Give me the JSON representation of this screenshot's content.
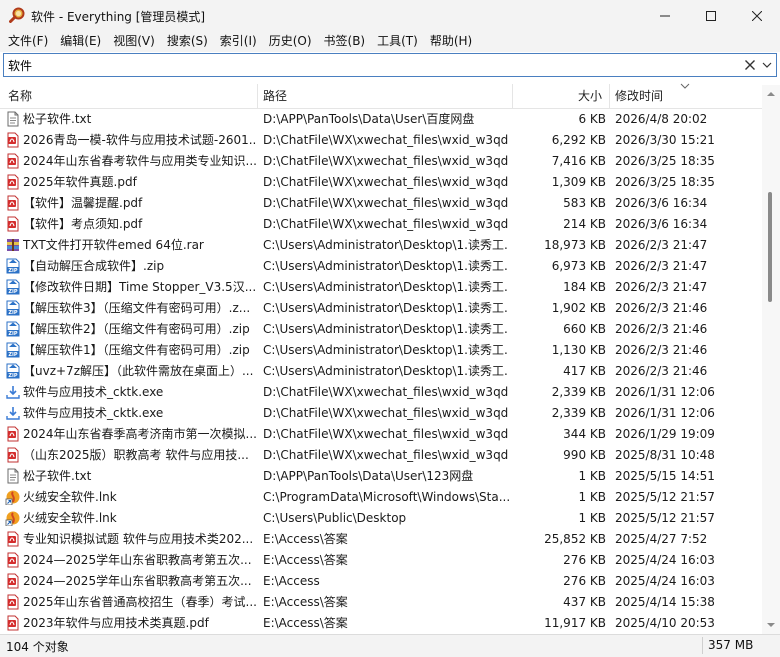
{
  "window": {
    "title": "软件 - Everything [管理员模式]",
    "icon": "magnifier-app-icon",
    "minimize_icon": "minimize-icon",
    "maximize_icon": "maximize-icon",
    "close_icon": "close-icon"
  },
  "menu": [
    "文件(F)",
    "编辑(E)",
    "视图(V)",
    "搜索(S)",
    "索引(I)",
    "历史(O)",
    "书签(B)",
    "工具(T)",
    "帮助(H)"
  ],
  "search": {
    "value": "软件",
    "clear_icon": "close-icon",
    "dropdown_icon": "chevron-down-icon"
  },
  "columns": {
    "name": "名称",
    "path": "路径",
    "size": "大小",
    "modified": "修改时间"
  },
  "colors": {
    "accent": "#4a7fc0",
    "pdf": "#d42d2d",
    "zip": "#2c72c7",
    "exe": "#3a7bd5"
  },
  "files": [
    {
      "name": "松子软件.txt",
      "path": "D:\\APP\\PanTools\\Data\\User\\百度网盘",
      "size": "6 KB",
      "modified": "2026/4/8 20:02",
      "icon": "txt-file-icon"
    },
    {
      "name": "2026青岛一模-软件与应用技术试题-2601...",
      "path": "D:\\ChatFile\\WX\\xwechat_files\\wxid_w3qd...",
      "size": "6,292 KB",
      "modified": "2026/3/30 15:21",
      "icon": "pdf-file-icon"
    },
    {
      "name": "2024年山东省春考软件与应用类专业知识...",
      "path": "D:\\ChatFile\\WX\\xwechat_files\\wxid_w3qd...",
      "size": "7,416 KB",
      "modified": "2026/3/25 18:35",
      "icon": "pdf-file-icon"
    },
    {
      "name": "2025年软件真题.pdf",
      "path": "D:\\ChatFile\\WX\\xwechat_files\\wxid_w3qd...",
      "size": "1,309 KB",
      "modified": "2026/3/25 18:35",
      "icon": "pdf-file-icon"
    },
    {
      "name": "【软件】温馨提醒.pdf",
      "path": "D:\\ChatFile\\WX\\xwechat_files\\wxid_w3qd...",
      "size": "583 KB",
      "modified": "2026/3/6 16:34",
      "icon": "pdf-file-icon"
    },
    {
      "name": "【软件】考点须知.pdf",
      "path": "D:\\ChatFile\\WX\\xwechat_files\\wxid_w3qd...",
      "size": "214 KB",
      "modified": "2026/3/6 16:34",
      "icon": "pdf-file-icon"
    },
    {
      "name": "TXT文件打开软件emed 64位.rar",
      "path": "C:\\Users\\Administrator\\Desktop\\1.读秀工...",
      "size": "18,973 KB",
      "modified": "2026/2/3 21:47",
      "icon": "rar-file-icon"
    },
    {
      "name": "【自动解压合成软件】.zip",
      "path": "C:\\Users\\Administrator\\Desktop\\1.读秀工...",
      "size": "6,973 KB",
      "modified": "2026/2/3 21:47",
      "icon": "zip-file-icon"
    },
    {
      "name": "【修改软件日期】Time Stopper_V3.5汉...",
      "path": "C:\\Users\\Administrator\\Desktop\\1.读秀工...",
      "size": "184 KB",
      "modified": "2026/2/3 21:47",
      "icon": "zip-file-icon"
    },
    {
      "name": "【解压软件3】（压缩文件有密码可用）.z...",
      "path": "C:\\Users\\Administrator\\Desktop\\1.读秀工...",
      "size": "1,902 KB",
      "modified": "2026/2/3 21:46",
      "icon": "zip-file-icon"
    },
    {
      "name": "【解压软件2】（压缩文件有密码可用）.zip",
      "path": "C:\\Users\\Administrator\\Desktop\\1.读秀工...",
      "size": "660 KB",
      "modified": "2026/2/3 21:46",
      "icon": "zip-file-icon"
    },
    {
      "name": "【解压软件1】（压缩文件有密码可用）.zip",
      "path": "C:\\Users\\Administrator\\Desktop\\1.读秀工...",
      "size": "1,130 KB",
      "modified": "2026/2/3 21:46",
      "icon": "zip-file-icon"
    },
    {
      "name": "【uvz+7z解压】（此软件需放在桌面上）...",
      "path": "C:\\Users\\Administrator\\Desktop\\1.读秀工...",
      "size": "417 KB",
      "modified": "2026/2/3 21:46",
      "icon": "zip-file-icon"
    },
    {
      "name": "软件与应用技术_cktk.exe",
      "path": "D:\\ChatFile\\WX\\xwechat_files\\wxid_w3qd...",
      "size": "2,339 KB",
      "modified": "2026/1/31 12:06",
      "icon": "installer-exe-icon"
    },
    {
      "name": "软件与应用技术_cktk.exe",
      "path": "D:\\ChatFile\\WX\\xwechat_files\\wxid_w3qd...",
      "size": "2,339 KB",
      "modified": "2026/1/31 12:06",
      "icon": "installer-exe-icon"
    },
    {
      "name": "2024年山东省春季高考济南市第一次模拟...",
      "path": "D:\\ChatFile\\WX\\xwechat_files\\wxid_w3qd...",
      "size": "344 KB",
      "modified": "2026/1/29 19:09",
      "icon": "pdf-file-icon"
    },
    {
      "name": "（山东2025版）职教高考 软件与应用技...",
      "path": "D:\\ChatFile\\WX\\xwechat_files\\wxid_w3qd...",
      "size": "990 KB",
      "modified": "2025/8/31 10:48",
      "icon": "pdf-file-icon"
    },
    {
      "name": "松子软件.txt",
      "path": "D:\\APP\\PanTools\\Data\\User\\123网盘",
      "size": "1 KB",
      "modified": "2025/5/15 14:51",
      "icon": "txt-file-icon"
    },
    {
      "name": "火绒安全软件.lnk",
      "path": "C:\\ProgramData\\Microsoft\\Windows\\Sta...",
      "size": "1 KB",
      "modified": "2025/5/12 21:57",
      "icon": "shortcut-icon"
    },
    {
      "name": "火绒安全软件.lnk",
      "path": "C:\\Users\\Public\\Desktop",
      "size": "1 KB",
      "modified": "2025/5/12 21:57",
      "icon": "shortcut-icon"
    },
    {
      "name": "专业知识模拟试题 软件与应用技术类202...",
      "path": "E:\\Access\\答案",
      "size": "25,852 KB",
      "modified": "2025/4/27 7:52",
      "icon": "pdf-file-icon"
    },
    {
      "name": "2024—2025学年山东省职教高考第五次...",
      "path": "E:\\Access\\答案",
      "size": "276 KB",
      "modified": "2025/4/24 16:03",
      "icon": "pdf-file-icon"
    },
    {
      "name": "2024—2025学年山东省职教高考第五次...",
      "path": "E:\\Access",
      "size": "276 KB",
      "modified": "2025/4/24 16:03",
      "icon": "pdf-file-icon"
    },
    {
      "name": "2025年山东省普通高校招生（春季）考试...",
      "path": "E:\\Access\\答案",
      "size": "437 KB",
      "modified": "2025/4/14 15:38",
      "icon": "pdf-file-icon"
    },
    {
      "name": "2023年软件与应用技术类真题.pdf",
      "path": "E:\\Access\\答案",
      "size": "11,917 KB",
      "modified": "2025/4/10 20:53",
      "icon": "pdf-file-icon"
    }
  ],
  "status": {
    "count": "104 个对象",
    "total_size": "357 MB"
  }
}
